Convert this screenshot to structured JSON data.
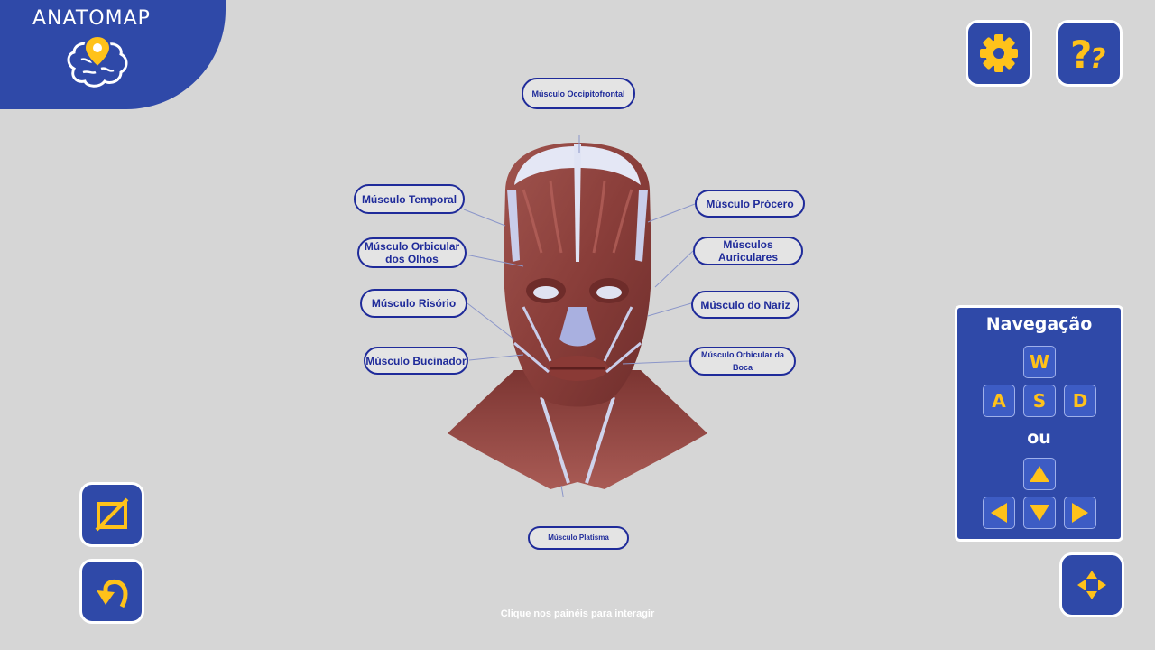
{
  "app": {
    "logo_text": "ANATOMAP"
  },
  "labels": {
    "occipitofrontal": "Músculo Occipitofrontal",
    "temporal": "Músculo Temporal",
    "orbicular_olhos": "Músculo Orbicular dos Olhos",
    "risorio": "Músculo Risório",
    "bucinador": "Músculo Bucinador",
    "procero": "Músculo Prócero",
    "auriculares": "Músculos Auriculares",
    "nariz": "Músculo do Nariz",
    "orbicular_boca": "Músculo Orbicular da Boca",
    "platisma": "Músculo Platisma"
  },
  "navigation": {
    "title": "Navegação",
    "or_text": "ou",
    "keys": {
      "w": "W",
      "a": "A",
      "s": "S",
      "d": "D"
    }
  },
  "hint": "Clique nos painéis para interagir",
  "icons": {
    "settings": "gear-icon",
    "help": "help-icon",
    "hide_labels": "no-labels-icon",
    "back": "undo-icon",
    "move": "move-arrows-icon"
  },
  "colors": {
    "panel_blue": "#2f49a8",
    "accent": "#ffc21a",
    "label_border": "#1f2b9a",
    "background": "#d6d6d6"
  }
}
